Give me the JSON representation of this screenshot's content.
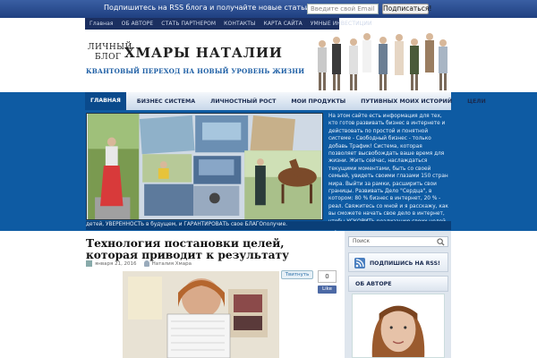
{
  "rss_bar": {
    "message": "Подпишитесь на RSS блога и получайте новые статьи на почту!",
    "email_placeholder": "Введите свой Email",
    "subscribe_label": "Подписаться!"
  },
  "top_nav": [
    "Главная",
    "ОБ АВТОРЕ",
    "СТАТЬ ПАРТНЕРОМ",
    "КОНТАКТЫ",
    "КАРТА САЙТА",
    "УМНЫЕ ИНВЕСТИЦИИ"
  ],
  "header": {
    "logo_small_1": "ЛИЧНЫЙ",
    "logo_small_2": "БЛОГ",
    "logo_big": "ХМАРЫ НАТАЛИИ",
    "tagline": "КВАНТОВЫЙ ПЕРЕХОД НА НОВЫЙ УРОВЕНЬ ЖИЗНИ"
  },
  "main_nav": [
    "ГЛАВНАЯ",
    "БИЗНЕС СИСТЕМА",
    "ЛИЧНОСТНЫЙ РОСТ",
    "МОИ ПРОДУКТЫ",
    "ПУТИВНЫХ МОИХ ИСТОРИЙ",
    "ЦЕЛИ"
  ],
  "featured": {
    "text": "На этом сайте есть информация для тех, кто готов развивать бизнес в интернете и действовать по простой и понятной системе - Свободный бизнес - только добавь Трафик! Система, которая позволяет высвобождать ваше время для жизни. Жить сейчас, наслаждаться текущими моментами, быть со своей семьей, увидеть своими глазами 150 стран мира. Выйти за рамки, расширить свои границы. Развивать Дело \"Сердца\", в котором: 80 % бизнес в интернет, 20 % - реал. Свяжитесь со мной и я расскажу, как вы сможете начать свое дело в интернет, чтобы УСКОРИТЬ реализацию своих целей, обрести СТАБИЛЬНОСТЬ вне зависимости от государства, и СПОКОЙСТВИЕ за свою семью и",
    "strip": "детей, УВЕРЕННОСТЬ в будущем, и ГАРАНТИРОВАТЬ свое БЛАГОполучие."
  },
  "post": {
    "title": "Технология постановки целей, которая приводит к результату",
    "date": "января 21, 2016",
    "author": "Наталия Хмара",
    "tweet_label": "Твитнуть",
    "like_count": "0",
    "like_label": "Like"
  },
  "sidebar": {
    "search_placeholder": "Поиск",
    "rss_label": "ПОДПИШИСЬ НА RSS!",
    "about_label": "ОБ АВТОРЕ"
  },
  "colors": {
    "accent_blue": "#0e5ba3",
    "nav_dark": "#1b2f60",
    "tagline_blue": "#1e5fa5"
  }
}
